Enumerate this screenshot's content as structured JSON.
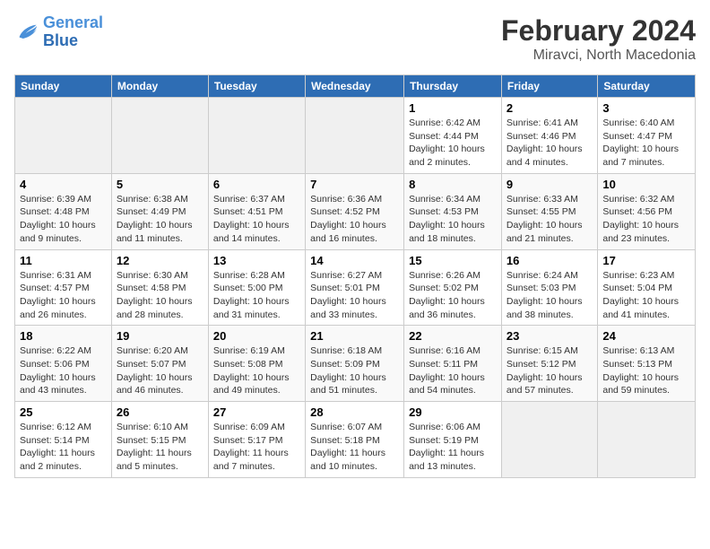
{
  "header": {
    "logo_line1": "General",
    "logo_line2": "Blue",
    "month_year": "February 2024",
    "location": "Miravci, North Macedonia"
  },
  "days_of_week": [
    "Sunday",
    "Monday",
    "Tuesday",
    "Wednesday",
    "Thursday",
    "Friday",
    "Saturday"
  ],
  "weeks": [
    [
      {
        "num": "",
        "empty": true
      },
      {
        "num": "",
        "empty": true
      },
      {
        "num": "",
        "empty": true
      },
      {
        "num": "",
        "empty": true
      },
      {
        "num": "1",
        "sunrise": "6:42 AM",
        "sunset": "4:44 PM",
        "daylight": "10 hours and 2 minutes."
      },
      {
        "num": "2",
        "sunrise": "6:41 AM",
        "sunset": "4:46 PM",
        "daylight": "10 hours and 4 minutes."
      },
      {
        "num": "3",
        "sunrise": "6:40 AM",
        "sunset": "4:47 PM",
        "daylight": "10 hours and 7 minutes."
      }
    ],
    [
      {
        "num": "4",
        "sunrise": "6:39 AM",
        "sunset": "4:48 PM",
        "daylight": "10 hours and 9 minutes."
      },
      {
        "num": "5",
        "sunrise": "6:38 AM",
        "sunset": "4:49 PM",
        "daylight": "10 hours and 11 minutes."
      },
      {
        "num": "6",
        "sunrise": "6:37 AM",
        "sunset": "4:51 PM",
        "daylight": "10 hours and 14 minutes."
      },
      {
        "num": "7",
        "sunrise": "6:36 AM",
        "sunset": "4:52 PM",
        "daylight": "10 hours and 16 minutes."
      },
      {
        "num": "8",
        "sunrise": "6:34 AM",
        "sunset": "4:53 PM",
        "daylight": "10 hours and 18 minutes."
      },
      {
        "num": "9",
        "sunrise": "6:33 AM",
        "sunset": "4:55 PM",
        "daylight": "10 hours and 21 minutes."
      },
      {
        "num": "10",
        "sunrise": "6:32 AM",
        "sunset": "4:56 PM",
        "daylight": "10 hours and 23 minutes."
      }
    ],
    [
      {
        "num": "11",
        "sunrise": "6:31 AM",
        "sunset": "4:57 PM",
        "daylight": "10 hours and 26 minutes."
      },
      {
        "num": "12",
        "sunrise": "6:30 AM",
        "sunset": "4:58 PM",
        "daylight": "10 hours and 28 minutes."
      },
      {
        "num": "13",
        "sunrise": "6:28 AM",
        "sunset": "5:00 PM",
        "daylight": "10 hours and 31 minutes."
      },
      {
        "num": "14",
        "sunrise": "6:27 AM",
        "sunset": "5:01 PM",
        "daylight": "10 hours and 33 minutes."
      },
      {
        "num": "15",
        "sunrise": "6:26 AM",
        "sunset": "5:02 PM",
        "daylight": "10 hours and 36 minutes."
      },
      {
        "num": "16",
        "sunrise": "6:24 AM",
        "sunset": "5:03 PM",
        "daylight": "10 hours and 38 minutes."
      },
      {
        "num": "17",
        "sunrise": "6:23 AM",
        "sunset": "5:04 PM",
        "daylight": "10 hours and 41 minutes."
      }
    ],
    [
      {
        "num": "18",
        "sunrise": "6:22 AM",
        "sunset": "5:06 PM",
        "daylight": "10 hours and 43 minutes."
      },
      {
        "num": "19",
        "sunrise": "6:20 AM",
        "sunset": "5:07 PM",
        "daylight": "10 hours and 46 minutes."
      },
      {
        "num": "20",
        "sunrise": "6:19 AM",
        "sunset": "5:08 PM",
        "daylight": "10 hours and 49 minutes."
      },
      {
        "num": "21",
        "sunrise": "6:18 AM",
        "sunset": "5:09 PM",
        "daylight": "10 hours and 51 minutes."
      },
      {
        "num": "22",
        "sunrise": "6:16 AM",
        "sunset": "5:11 PM",
        "daylight": "10 hours and 54 minutes."
      },
      {
        "num": "23",
        "sunrise": "6:15 AM",
        "sunset": "5:12 PM",
        "daylight": "10 hours and 57 minutes."
      },
      {
        "num": "24",
        "sunrise": "6:13 AM",
        "sunset": "5:13 PM",
        "daylight": "10 hours and 59 minutes."
      }
    ],
    [
      {
        "num": "25",
        "sunrise": "6:12 AM",
        "sunset": "5:14 PM",
        "daylight": "11 hours and 2 minutes."
      },
      {
        "num": "26",
        "sunrise": "6:10 AM",
        "sunset": "5:15 PM",
        "daylight": "11 hours and 5 minutes."
      },
      {
        "num": "27",
        "sunrise": "6:09 AM",
        "sunset": "5:17 PM",
        "daylight": "11 hours and 7 minutes."
      },
      {
        "num": "28",
        "sunrise": "6:07 AM",
        "sunset": "5:18 PM",
        "daylight": "11 hours and 10 minutes."
      },
      {
        "num": "29",
        "sunrise": "6:06 AM",
        "sunset": "5:19 PM",
        "daylight": "11 hours and 13 minutes."
      },
      {
        "num": "",
        "empty": true
      },
      {
        "num": "",
        "empty": true
      }
    ]
  ]
}
